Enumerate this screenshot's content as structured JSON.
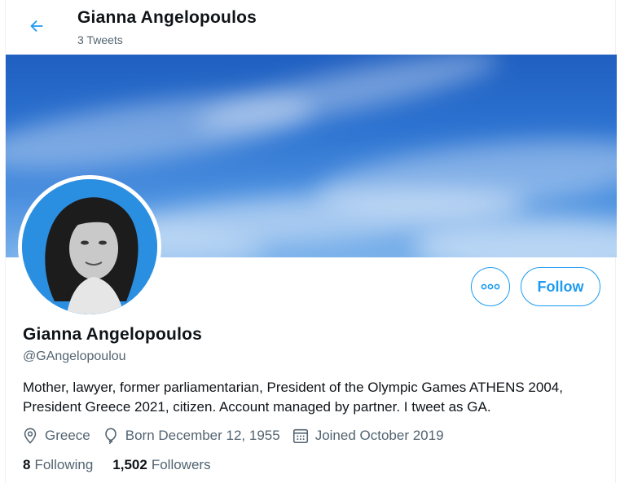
{
  "header": {
    "title": "Gianna Angelopoulos",
    "subtitle": "3 Tweets",
    "back_icon": "arrow-left-icon"
  },
  "colors": {
    "accent": "#1d9bf0",
    "secondary_text": "#536471",
    "primary_text": "#0f1419"
  },
  "actions": {
    "more_icon": "more-dots-icon",
    "follow_label": "Follow"
  },
  "profile": {
    "name": "Gianna Angelopoulos",
    "handle": "@GAngelopoulou",
    "bio": "Mother, lawyer, former parliamentarian, President of the Olympic Games ATHENS 2004, President Greece 2021, citizen. Account managed by partner. I tweet as GA.",
    "location": "Greece",
    "birthday": "Born December 12, 1955",
    "joined": "Joined October 2019"
  },
  "stats": {
    "following_count": "8",
    "following_label": "Following",
    "followers_count": "1,502",
    "followers_label": "Followers"
  }
}
